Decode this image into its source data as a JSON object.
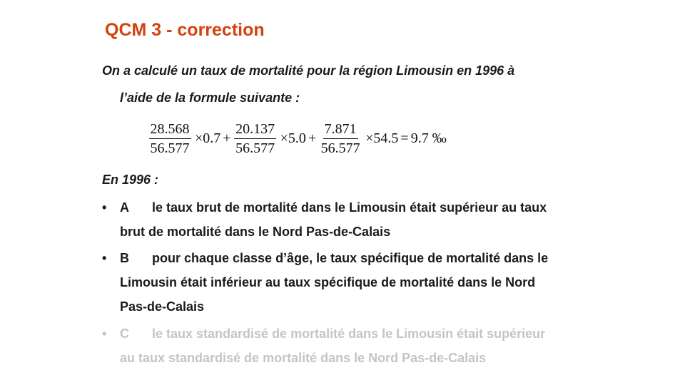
{
  "title": "QCM 3 - correction",
  "intro": {
    "line1": "On a calculé un taux de mortalité pour la région Limousin en 1996 à",
    "line2": "l’aide de la formule suivante :"
  },
  "formula": {
    "frac1_num": "28.568",
    "frac1_den": "56.577",
    "factor1": "×0.7",
    "plus1": "+",
    "frac2_num": "20.137",
    "frac2_den": "56.577",
    "factor2": "×5.0",
    "plus2": "+",
    "frac3_num": "7.871",
    "frac3_den": "56.577",
    "factor3": "×54.5",
    "equals": "=",
    "result": "9.7 ‰"
  },
  "section_label": "En 1996 :",
  "options": {
    "a": {
      "bullet": "•",
      "letter": "A",
      "line1": "le taux brut de mortalité dans le Limousin était supérieur au taux",
      "line2": "brut de mortalité dans le Nord Pas-de-Calais"
    },
    "b": {
      "bullet": "•",
      "letter": "B",
      "line1": "pour chaque classe d’âge, le taux spécifique de mortalité dans le",
      "line2": "Limousin était inférieur au taux spécifique de mortalité dans le Nord",
      "line3": "Pas-de-Calais"
    },
    "c": {
      "bullet": "•",
      "letter": "C",
      "line1": "le taux standardisé de mortalité dans le Limousin était supérieur",
      "line2": "au taux standardisé de mortalité dans le Nord Pas-de-Calais"
    }
  },
  "colors": {
    "title": "#d4420e",
    "text": "#1a1a1a",
    "faded": "#c4c4c4"
  }
}
